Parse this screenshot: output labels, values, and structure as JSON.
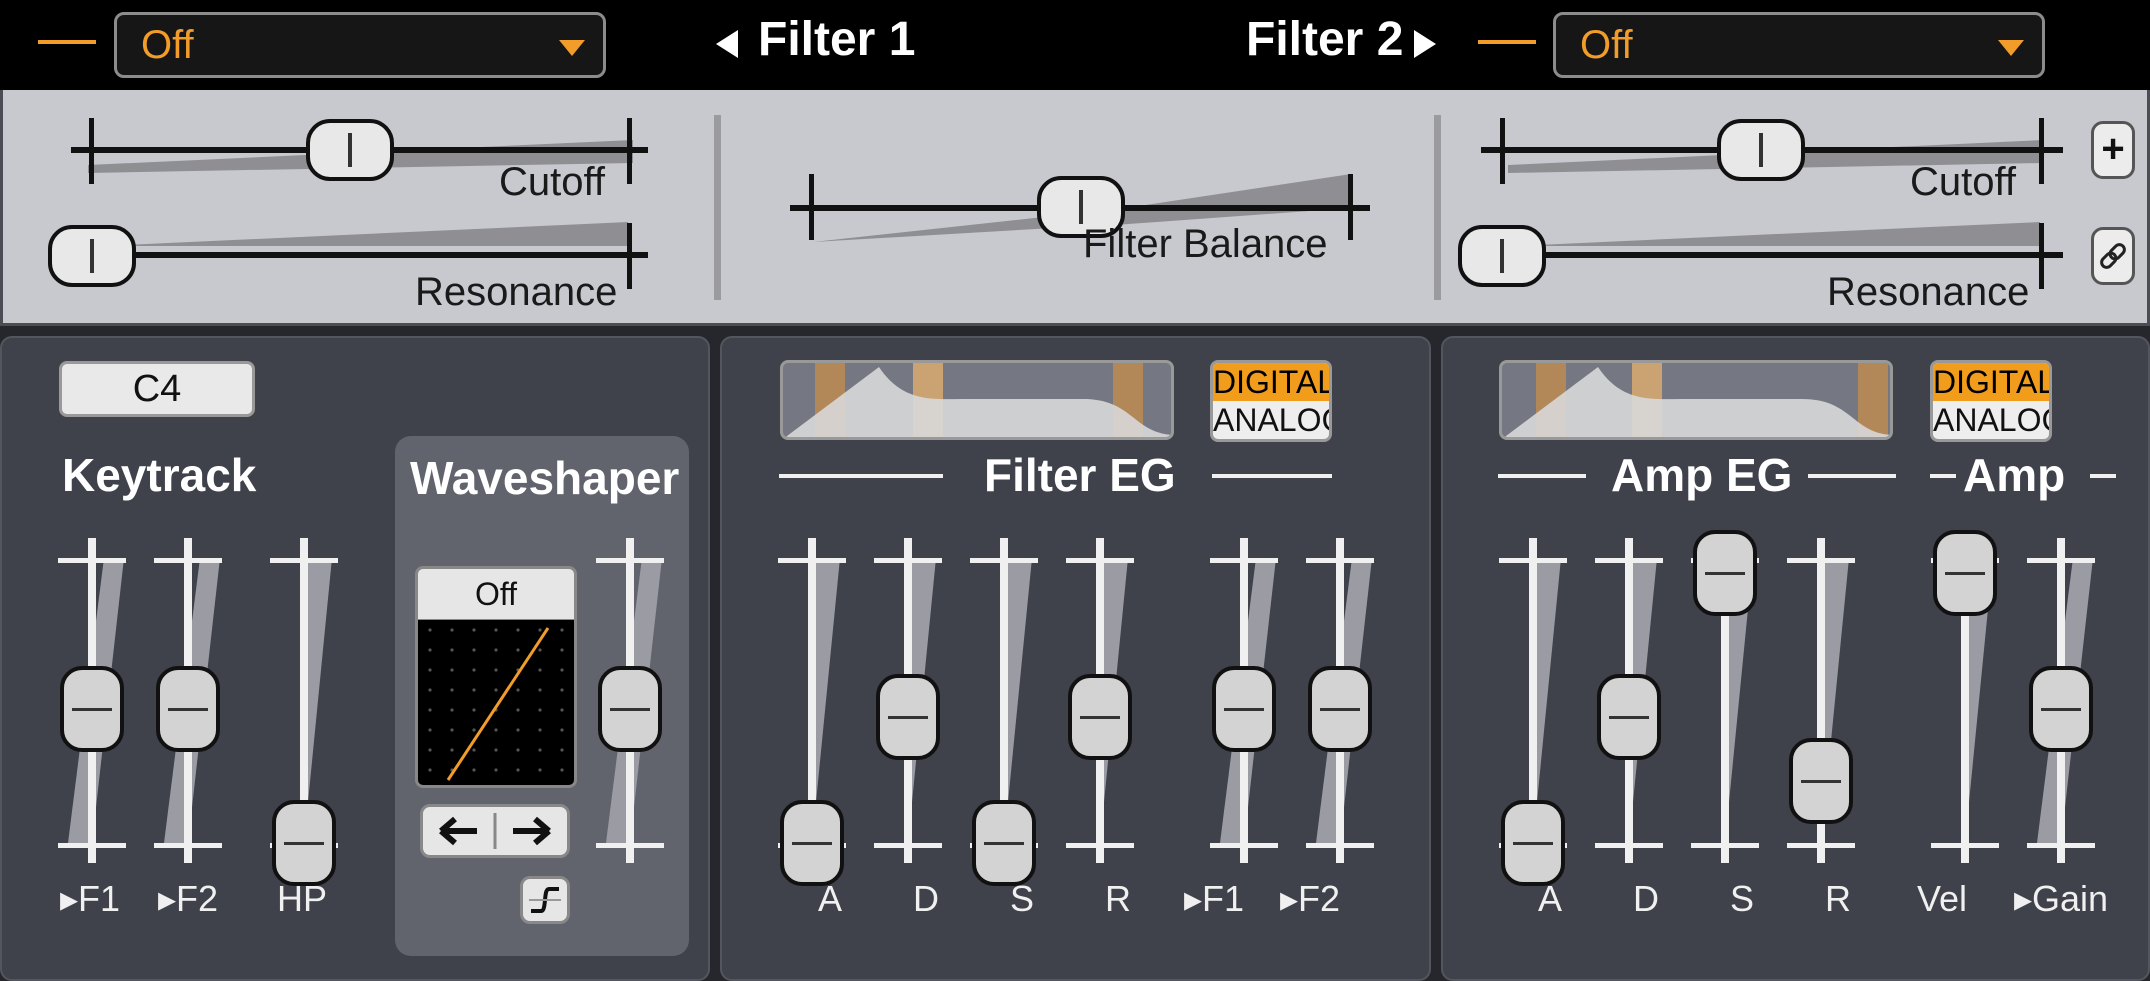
{
  "filter1": {
    "title": "Filter 1",
    "type_value": "Off",
    "cutoff_label": "Cutoff",
    "resonance_label": "Resonance",
    "cutoff_level": 0.42,
    "resonance_level": 0.0
  },
  "filter2": {
    "title": "Filter 2",
    "type_value": "Off",
    "cutoff_label": "Cutoff",
    "resonance_label": "Resonance",
    "cutoff_level": 0.46,
    "resonance_level": 0.0
  },
  "balance": {
    "label": "Filter Balance",
    "level": 0.5
  },
  "side_buttons": {
    "add": "+"
  },
  "keytrack": {
    "note": "C4",
    "title": "Keytrack",
    "labels": [
      "F1",
      "F2",
      "HP"
    ]
  },
  "waveshaper": {
    "title": "Waveshaper",
    "mode": "Off"
  },
  "filter_eg": {
    "title": "Filter EG",
    "digital": "DIGITAL",
    "analog": "ANALOG",
    "labels": [
      "A",
      "D",
      "S",
      "R",
      "F1",
      "F2"
    ]
  },
  "amp_eg": {
    "title": "Amp EG",
    "amp_title": "Amp",
    "digital": "DIGITAL",
    "analog": "ANALOG",
    "labels": [
      "A",
      "D",
      "S",
      "R",
      "Vel",
      "Gain"
    ]
  },
  "colors": {
    "accent": "#f29c2a",
    "panel": "#3f414b",
    "filter_bg": "#c8c9cf"
  },
  "icons": [
    "chevron-left-icon",
    "chevron-right-icon",
    "dropdown-arrow-icon",
    "plus-icon",
    "link-icon",
    "curve-icon",
    "arrow-left-icon",
    "arrow-right-icon"
  ]
}
